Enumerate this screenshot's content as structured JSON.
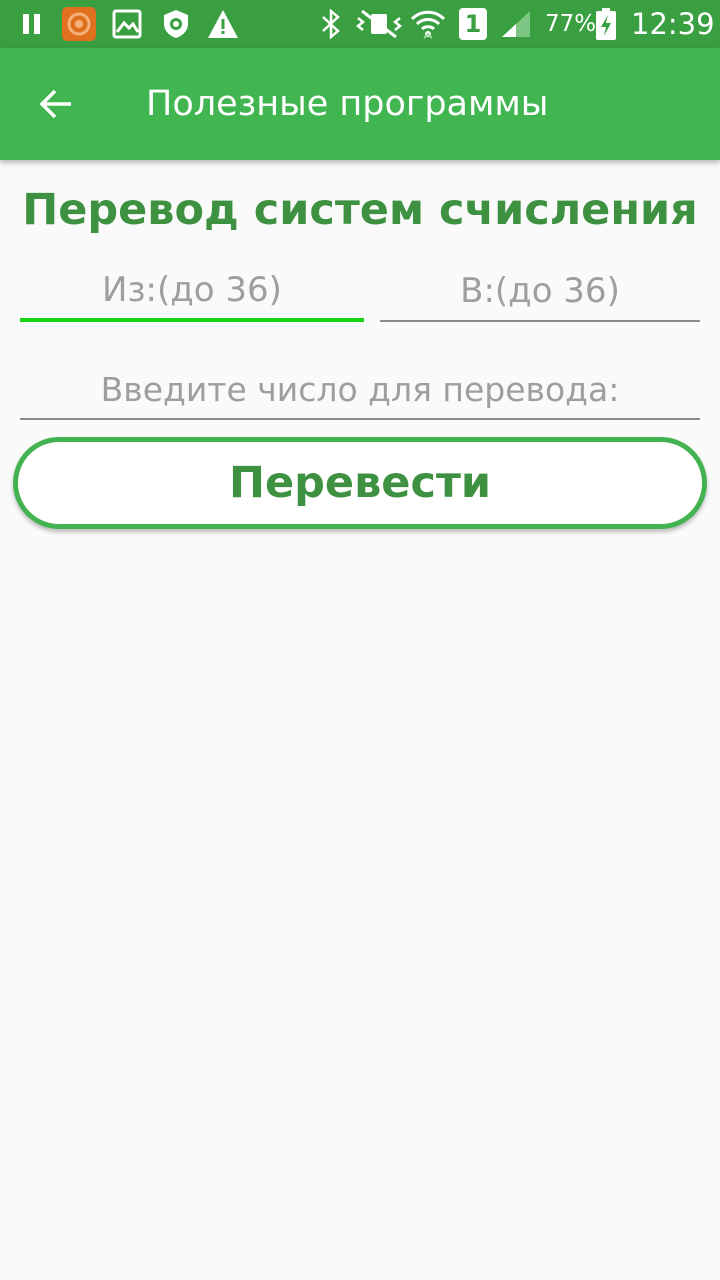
{
  "status_bar": {
    "battery_percent": "77%",
    "time": "12:39",
    "sim_number": "1",
    "icons": [
      "pause-icon",
      "app-notification-icon",
      "image-icon",
      "antivirus-shield-icon",
      "warning-icon",
      "bluetooth-icon",
      "vibrate-icon",
      "wifi-icon",
      "sim-icon",
      "signal-icon",
      "battery-charging-icon"
    ]
  },
  "app_bar": {
    "title": "Полезные программы",
    "back_icon": "arrow-back-icon"
  },
  "converter": {
    "title": "Перевод систем счисления",
    "from_placeholder": "Из:(до 36)",
    "to_placeholder": "В:(до 36)",
    "number_placeholder": "Введите число для перевода:",
    "button_label": "Перевести"
  },
  "colors": {
    "status_bar": "#399f41",
    "app_bar": "#40b550",
    "accent_text": "#3d9140",
    "focused_underline": "#19d419",
    "button_border": "#43b352",
    "background": "#fafafa"
  }
}
